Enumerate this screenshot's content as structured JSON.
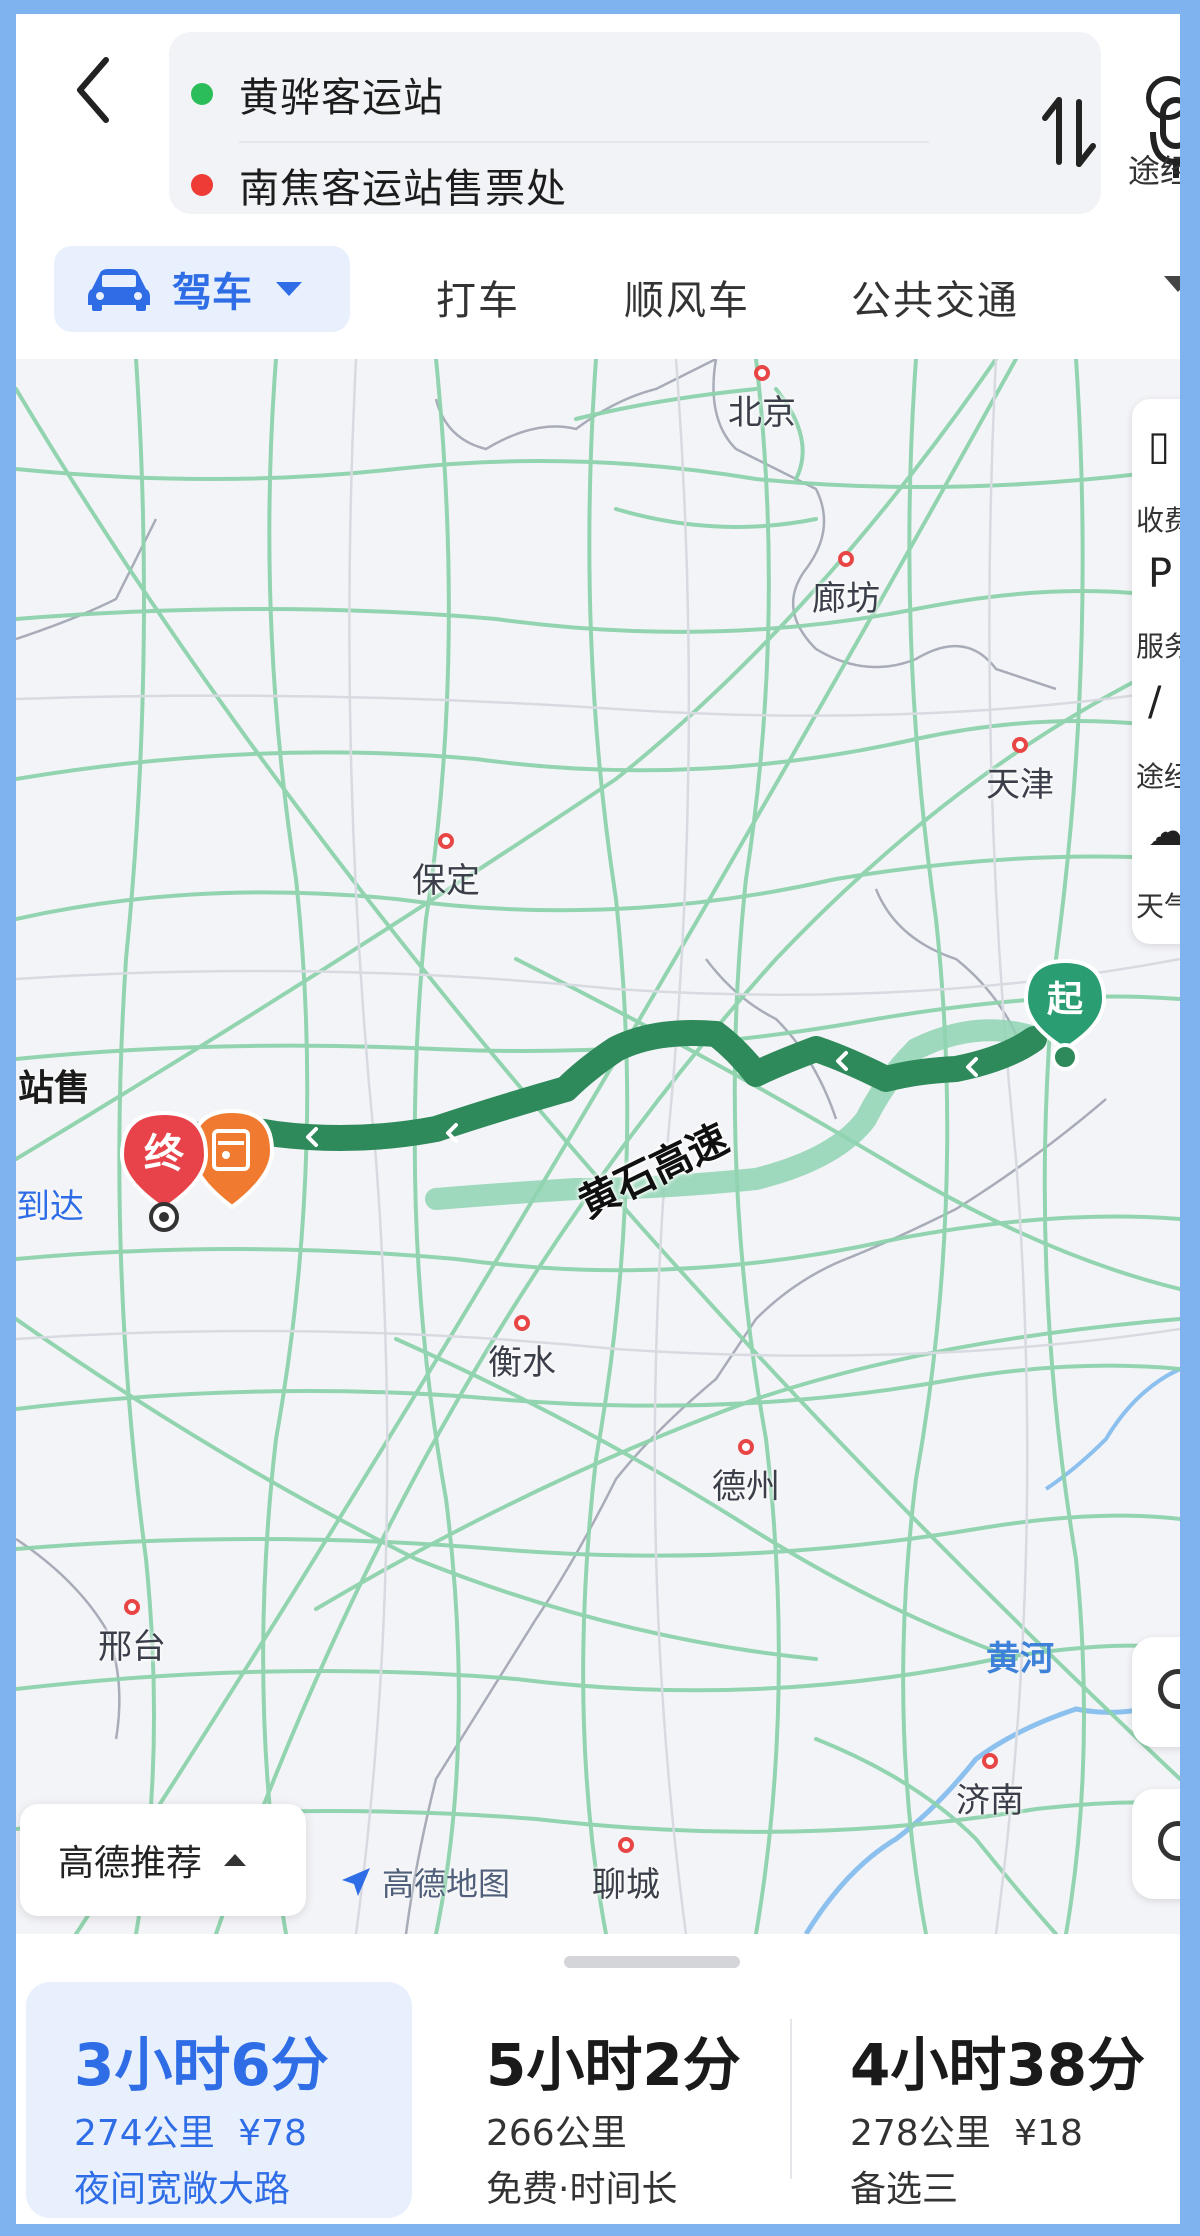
{
  "route_input": {
    "origin": "黄骅客运站",
    "destination": "南焦客运站售票处"
  },
  "waypoint_label": "途经",
  "mode_tabs": {
    "active": "驾车",
    "tabs": [
      "打车",
      "顺风车",
      "公共交通"
    ]
  },
  "map": {
    "cities": [
      "北京",
      "廊坊",
      "天津",
      "保定",
      "衡水",
      "德州",
      "邢台",
      "济南",
      "聊城"
    ],
    "river": "黄河",
    "road_label": "黄石高速",
    "start_marker": "起",
    "end_marker": "终",
    "edge_dest_label": "站售",
    "edge_arrive_label": "到达",
    "side_panel": [
      "收费",
      "服务",
      "途经",
      "天气"
    ],
    "recommend": "高德推荐",
    "logo": "高德地图"
  },
  "route_options": [
    {
      "time": "3小时6分",
      "distance": "274公里",
      "cost": "¥78",
      "note": "夜间宽敞大路",
      "selected": true
    },
    {
      "time": "5小时2分",
      "distance": "266公里",
      "cost": "",
      "note": "免费·时间长",
      "selected": false
    },
    {
      "time": "4小时38分",
      "distance": "278公里",
      "cost": "¥18",
      "note": "备选三",
      "selected": false
    }
  ],
  "colors": {
    "accent": "#2f6de6",
    "route_green": "#2e8a5a",
    "alt_route": "#8fd3b3",
    "road": "#8ed3ad",
    "start_pin": "#2a9d72",
    "end_pin": "#e8434a",
    "toll_pin": "#f07a30"
  }
}
